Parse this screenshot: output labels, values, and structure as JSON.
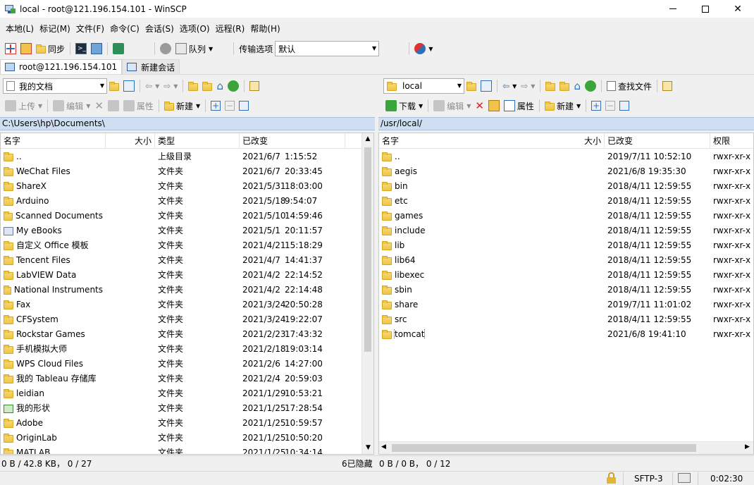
{
  "window": {
    "title": "local - root@121.196.154.101 - WinSCP"
  },
  "menu": [
    "本地(L)",
    "标记(M)",
    "文件(F)",
    "命令(C)",
    "会话(S)",
    "选项(O)",
    "远程(R)",
    "帮助(H)"
  ],
  "toolbar": {
    "sync_label": "同步",
    "queue_label": "队列",
    "transfer_options_label": "传输选项",
    "transfer_preset": "默认"
  },
  "tabs": {
    "session": "root@121.196.154.101",
    "new_session": "新建会话"
  },
  "left": {
    "location": "我的文档",
    "upload_label": "上传",
    "edit_label": "编辑",
    "properties_label": "属性",
    "new_label": "新建",
    "path": "C:\\Users\\hp\\Documents\\",
    "columns": {
      "name": "名字",
      "size": "大小",
      "type": "类型",
      "changed": "已改变"
    },
    "rows": [
      {
        "name": "..",
        "icon": "up",
        "type": "上级目录",
        "date": "2021/6/7",
        "time": "1:15:52"
      },
      {
        "name": "WeChat Files",
        "icon": "folder",
        "type": "文件夹",
        "date": "2021/6/7",
        "time": "20:33:45"
      },
      {
        "name": "ShareX",
        "icon": "folder",
        "type": "文件夹",
        "date": "2021/5/31",
        "time": "18:03:00"
      },
      {
        "name": "Arduino",
        "icon": "folder",
        "type": "文件夹",
        "date": "2021/5/18",
        "time": "9:54:07"
      },
      {
        "name": "Scanned Documents",
        "icon": "folder",
        "type": "文件夹",
        "date": "2021/5/10",
        "time": "14:59:46"
      },
      {
        "name": "My eBooks",
        "icon": "special",
        "type": "文件夹",
        "date": "2021/5/1",
        "time": "20:11:57"
      },
      {
        "name": "自定义 Office 模板",
        "icon": "folder",
        "type": "文件夹",
        "date": "2021/4/21",
        "time": "15:18:29"
      },
      {
        "name": "Tencent Files",
        "icon": "folder",
        "type": "文件夹",
        "date": "2021/4/7",
        "time": "14:41:37"
      },
      {
        "name": "LabVIEW Data",
        "icon": "folder",
        "type": "文件夹",
        "date": "2021/4/2",
        "time": "22:14:52"
      },
      {
        "name": "National Instruments",
        "icon": "folder",
        "type": "文件夹",
        "date": "2021/4/2",
        "time": "22:14:48"
      },
      {
        "name": "Fax",
        "icon": "folder",
        "type": "文件夹",
        "date": "2021/3/24",
        "time": "20:50:28"
      },
      {
        "name": "CFSystem",
        "icon": "folder",
        "type": "文件夹",
        "date": "2021/3/24",
        "time": "19:22:07"
      },
      {
        "name": "Rockstar Games",
        "icon": "folder",
        "type": "文件夹",
        "date": "2021/2/23",
        "time": "17:43:32"
      },
      {
        "name": "手机模拟大师",
        "icon": "folder",
        "type": "文件夹",
        "date": "2021/2/18",
        "time": "19:03:14"
      },
      {
        "name": "WPS Cloud Files",
        "icon": "folder",
        "type": "文件夹",
        "date": "2021/2/6",
        "time": "14:27:00"
      },
      {
        "name": "我的 Tableau 存储库",
        "icon": "folder",
        "type": "文件夹",
        "date": "2021/2/4",
        "time": "20:59:03"
      },
      {
        "name": "leidian",
        "icon": "folder",
        "type": "文件夹",
        "date": "2021/1/29",
        "time": "10:53:21"
      },
      {
        "name": "我的形状",
        "icon": "special2",
        "type": "文件夹",
        "date": "2021/1/25",
        "time": "17:28:54"
      },
      {
        "name": "Adobe",
        "icon": "folder",
        "type": "文件夹",
        "date": "2021/1/25",
        "time": "10:59:57"
      },
      {
        "name": "OriginLab",
        "icon": "folder",
        "type": "文件夹",
        "date": "2021/1/25",
        "time": "10:50:20"
      },
      {
        "name": "MATLAB",
        "icon": "folder",
        "type": "文件夹",
        "date": "2021/1/25",
        "time": "10:34:14"
      }
    ],
    "status_selected": "0 B / 42.8 KB， 0 / 27",
    "status_hidden": "6已隐藏"
  },
  "right": {
    "location": "local",
    "find_label": "查找文件",
    "download_label": "下载",
    "edit_label": "编辑",
    "properties_label": "属性",
    "new_label": "新建",
    "path": "/usr/local/",
    "columns": {
      "name": "名字",
      "size": "大小",
      "changed": "已改变",
      "rights": "权限"
    },
    "rows": [
      {
        "name": "..",
        "icon": "up",
        "changed": "2019/7/11 10:52:10",
        "rights": "rwxr-xr-x"
      },
      {
        "name": "aegis",
        "icon": "folder",
        "changed": "2021/6/8 19:35:30",
        "rights": "rwxr-xr-x"
      },
      {
        "name": "bin",
        "icon": "folder",
        "changed": "2018/4/11 12:59:55",
        "rights": "rwxr-xr-x"
      },
      {
        "name": "etc",
        "icon": "folder",
        "changed": "2018/4/11 12:59:55",
        "rights": "rwxr-xr-x"
      },
      {
        "name": "games",
        "icon": "folder",
        "changed": "2018/4/11 12:59:55",
        "rights": "rwxr-xr-x"
      },
      {
        "name": "include",
        "icon": "folder",
        "changed": "2018/4/11 12:59:55",
        "rights": "rwxr-xr-x"
      },
      {
        "name": "lib",
        "icon": "folder",
        "changed": "2018/4/11 12:59:55",
        "rights": "rwxr-xr-x"
      },
      {
        "name": "lib64",
        "icon": "folder",
        "changed": "2018/4/11 12:59:55",
        "rights": "rwxr-xr-x"
      },
      {
        "name": "libexec",
        "icon": "folder",
        "changed": "2018/4/11 12:59:55",
        "rights": "rwxr-xr-x"
      },
      {
        "name": "sbin",
        "icon": "folder",
        "changed": "2018/4/11 12:59:55",
        "rights": "rwxr-xr-x"
      },
      {
        "name": "share",
        "icon": "folder",
        "changed": "2019/7/11 11:01:02",
        "rights": "rwxr-xr-x"
      },
      {
        "name": "src",
        "icon": "folder",
        "changed": "2018/4/11 12:59:55",
        "rights": "rwxr-xr-x"
      },
      {
        "name": "tomcat",
        "icon": "folder",
        "changed": "2021/6/8 19:41:10",
        "rights": "rwxr-xr-x"
      }
    ],
    "status_selected": "0 B / 0 B， 0 / 12"
  },
  "bottom": {
    "protocol": "SFTP-3",
    "elapsed": "0:02:30"
  }
}
